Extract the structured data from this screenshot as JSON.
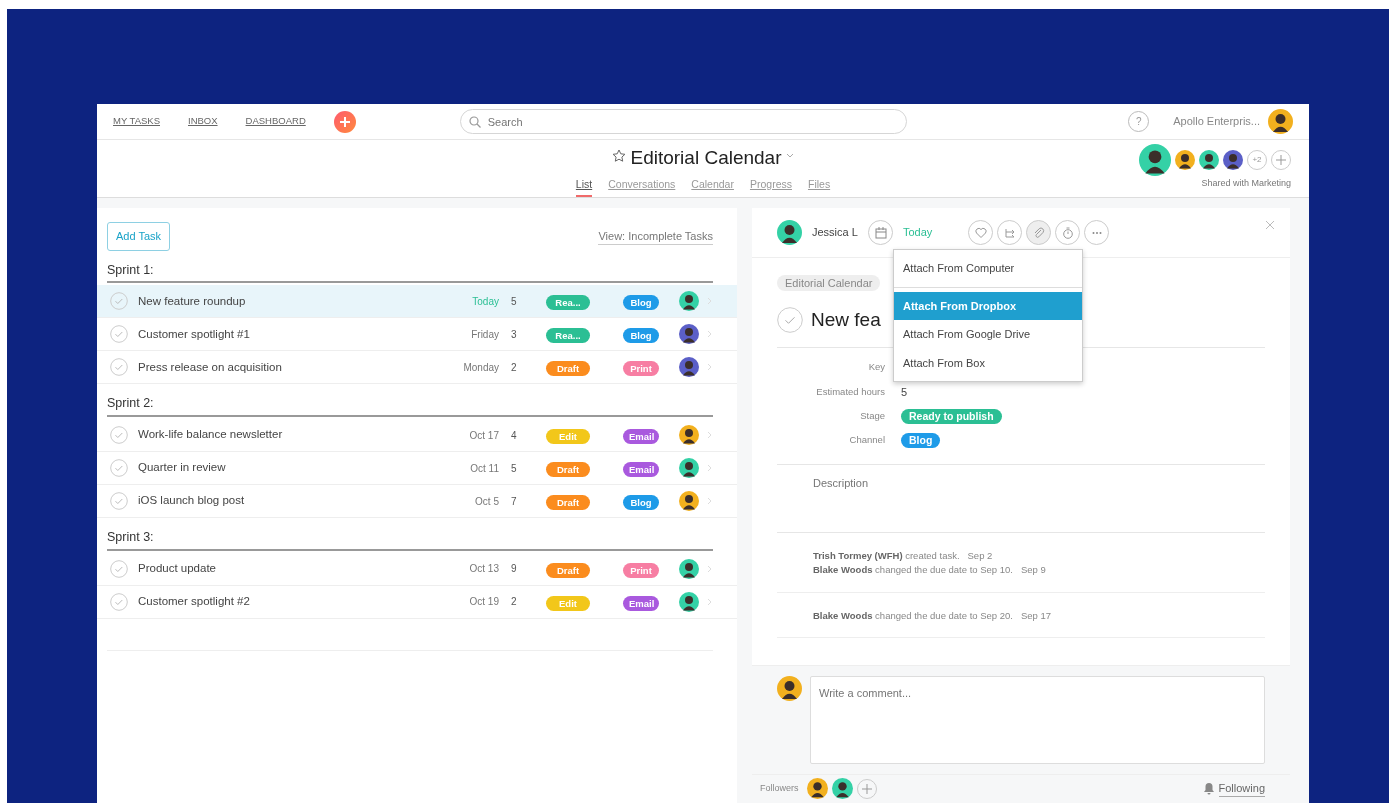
{
  "topnav": {
    "links": [
      "MY TASKS",
      "INBOX",
      "DASHBOARD"
    ],
    "search": {
      "placeholder": "Search"
    },
    "help": "?",
    "org": "Apollo Enterpris...",
    "user": {
      "color": "#f2b01e"
    }
  },
  "project": {
    "title": "Editorial Calendar",
    "tabs": [
      {
        "label": "List",
        "selected": true
      },
      {
        "label": "Conversations",
        "selected": false
      },
      {
        "label": "Calendar",
        "selected": false
      },
      {
        "label": "Progress",
        "selected": false
      },
      {
        "label": "Files",
        "selected": false
      }
    ],
    "members": [
      {
        "color": "#34d1a6"
      },
      {
        "color": "#f2b01e"
      },
      {
        "color": "#34d1a6"
      },
      {
        "color": "#5b5fc7"
      }
    ],
    "more": "+2",
    "shared": "Shared with Marketing"
  },
  "list": {
    "add_button": "Add Task",
    "view_filter": "View: Incomplete Tasks",
    "sections": [
      {
        "title": "Sprint 1:",
        "tasks": [
          {
            "name": "New feature roundup",
            "due": "Today",
            "due_today": true,
            "hours": "5",
            "stage": {
              "label": "Rea...",
              "color": "#2bbf94"
            },
            "channel": {
              "label": "Blog",
              "color": "#1e9be8"
            },
            "assignee": {
              "color": "#34d1a6"
            },
            "selected": true
          },
          {
            "name": "Customer spotlight #1",
            "due": "Friday",
            "due_today": false,
            "hours": "3",
            "stage": {
              "label": "Rea...",
              "color": "#2bbf94"
            },
            "channel": {
              "label": "Blog",
              "color": "#1e9be8"
            },
            "assignee": {
              "color": "#5b5fc7"
            },
            "selected": false
          },
          {
            "name": "Press release on acquisition",
            "due": "Monday",
            "due_today": false,
            "hours": "2",
            "stage": {
              "label": "Draft",
              "color": "#fb8c1e"
            },
            "channel": {
              "label": "Print",
              "color": "#f77ea3"
            },
            "assignee": {
              "color": "#5b5fc7"
            },
            "selected": false
          }
        ]
      },
      {
        "title": "Sprint 2:",
        "tasks": [
          {
            "name": "Work-life balance newsletter",
            "due": "Oct 17",
            "due_today": false,
            "hours": "4",
            "stage": {
              "label": "Edit",
              "color": "#f2c71a"
            },
            "channel": {
              "label": "Email",
              "color": "#a959de"
            },
            "assignee": {
              "color": "#f2b01e"
            },
            "selected": false
          },
          {
            "name": "Quarter in review",
            "due": "Oct 11",
            "due_today": false,
            "hours": "5",
            "stage": {
              "label": "Draft",
              "color": "#fb8c1e"
            },
            "channel": {
              "label": "Email",
              "color": "#a959de"
            },
            "assignee": {
              "color": "#34d1a6"
            },
            "selected": false
          },
          {
            "name": "iOS launch blog post",
            "due": "Oct 5",
            "due_today": false,
            "hours": "7",
            "stage": {
              "label": "Draft",
              "color": "#fb8c1e"
            },
            "channel": {
              "label": "Blog",
              "color": "#1e9be8"
            },
            "assignee": {
              "color": "#f2b01e"
            },
            "selected": false
          }
        ]
      },
      {
        "title": "Sprint 3:",
        "tasks": [
          {
            "name": "Product update",
            "due": "Oct 13",
            "due_today": false,
            "hours": "9",
            "stage": {
              "label": "Draft",
              "color": "#fb8c1e"
            },
            "channel": {
              "label": "Print",
              "color": "#f77ea3"
            },
            "assignee": {
              "color": "#34d1a6"
            },
            "selected": false
          },
          {
            "name": "Customer spotlight #2",
            "due": "Oct 19",
            "due_today": false,
            "hours": "2",
            "stage": {
              "label": "Edit",
              "color": "#f2c71a"
            },
            "channel": {
              "label": "Email",
              "color": "#a959de"
            },
            "assignee": {
              "color": "#34d1a6"
            },
            "selected": false
          }
        ]
      }
    ]
  },
  "detail": {
    "assignee": {
      "name": "Jessica L",
      "color": "#34d1a6"
    },
    "due": "Today",
    "toolbar": [
      {
        "kind": "heart",
        "active": false
      },
      {
        "kind": "subtask",
        "active": false
      },
      {
        "kind": "attach",
        "active": true
      },
      {
        "kind": "timer",
        "active": false
      },
      {
        "kind": "more",
        "active": false
      }
    ],
    "attach_menu": [
      {
        "label": "Attach From Computer",
        "selected": false,
        "separator_after": true
      },
      {
        "label": "Attach From Dropbox",
        "selected": true,
        "separator_after": false
      },
      {
        "label": "Attach From Google Drive",
        "selected": false,
        "separator_after": false
      },
      {
        "label": "Attach From Box",
        "selected": false,
        "separator_after": false
      }
    ],
    "breadcrumb": "Editorial Calendar",
    "title": "New fea",
    "fields": [
      {
        "label": "Key",
        "kind": "text"
      },
      {
        "label": "Estimated hours",
        "kind": "text",
        "value": "5"
      },
      {
        "label": "Stage",
        "kind": "pill",
        "value": "Ready to publish",
        "color": "#2bbf94"
      },
      {
        "label": "Channel",
        "kind": "pill",
        "value": "Blog",
        "color": "#1e9be8"
      }
    ],
    "description": {
      "placeholder": "Description"
    },
    "activity": [
      [
        "**Trish Tormey (WFH)** created task.   Sep 2",
        "**Blake Woods** changed the due date to Sep 10.   Sep 9"
      ],
      [
        "**Blake Woods** changed the due date to Sep 20.   Sep 17"
      ]
    ],
    "comment": {
      "placeholder": "Write a comment...",
      "author": {
        "color": "#f2b01e"
      }
    },
    "followers_label": "Followers",
    "followers": [
      {
        "color": "#f2b01e"
      },
      {
        "color": "#34d1a6"
      }
    ],
    "following": "Following"
  }
}
